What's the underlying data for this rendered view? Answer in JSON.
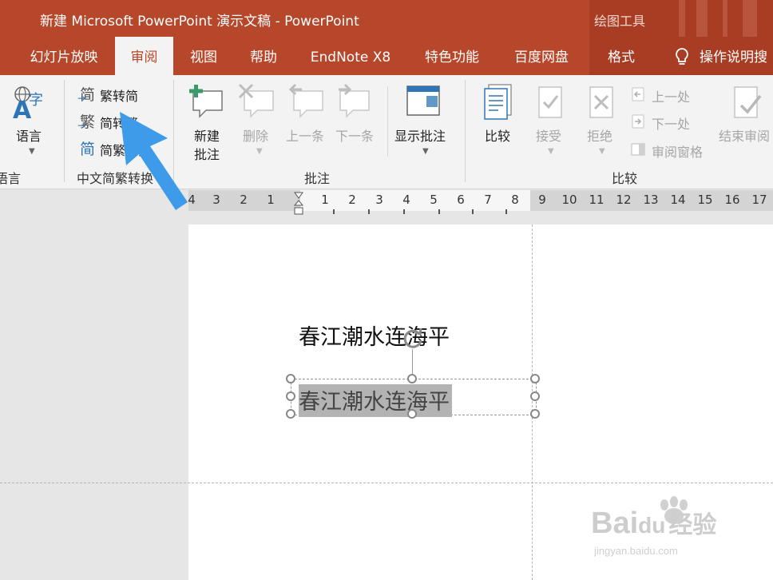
{
  "window": {
    "title": "新建 Microsoft PowerPoint 演示文稿  -  PowerPoint",
    "context_tab_group": "绘图工具"
  },
  "tabs": [
    {
      "label": "幻灯片放映",
      "active": false
    },
    {
      "label": "审阅",
      "active": true
    },
    {
      "label": "视图",
      "active": false
    },
    {
      "label": "帮助",
      "active": false
    },
    {
      "label": "EndNote X8",
      "active": false
    },
    {
      "label": "特色功能",
      "active": false
    },
    {
      "label": "百度网盘",
      "active": false
    },
    {
      "label": "格式",
      "active": false
    },
    {
      "label": "操作说明搜",
      "active": false
    }
  ],
  "ribbon": {
    "language": {
      "button": "语言",
      "group_label": "语言"
    },
    "chinese_convert": {
      "items": [
        "繁转简",
        "简转繁",
        "简繁转换"
      ],
      "icon_chars": [
        "简",
        "繁",
        "简"
      ],
      "group_label": "中文简繁转换"
    },
    "comments": {
      "new_comment": [
        "新建",
        "批注"
      ],
      "delete": "删除",
      "previous": "上一条",
      "next": "下一条",
      "show_comments": "显示批注",
      "group_label": "批注"
    },
    "compare": {
      "compare": "比较",
      "accept": "接受",
      "reject": "拒绝",
      "prev_change": "上一处",
      "next_change": "下一处",
      "review_pane": "审阅窗格",
      "end_review": "结束审阅",
      "group_label": "比较"
    }
  },
  "ruler": {
    "left_numbers": [
      "4",
      "3",
      "2",
      "1"
    ],
    "right_numbers": [
      "1",
      "2",
      "3",
      "4",
      "5",
      "6",
      "7",
      "8",
      "9",
      "10",
      "11",
      "12",
      "13",
      "14",
      "15",
      "16",
      "17"
    ]
  },
  "slide": {
    "text_original": "春江潮水连海平",
    "text_selected": "春江潮水连海平"
  },
  "watermark": {
    "brand_left": "Bai",
    "brand_mid": "du",
    "brand_cn": "经验",
    "url": "jingyan.baidu.com"
  },
  "colors": {
    "accent": "#b7472a",
    "blue_icon": "#2e75b6",
    "arrow": "#3d9be9"
  }
}
